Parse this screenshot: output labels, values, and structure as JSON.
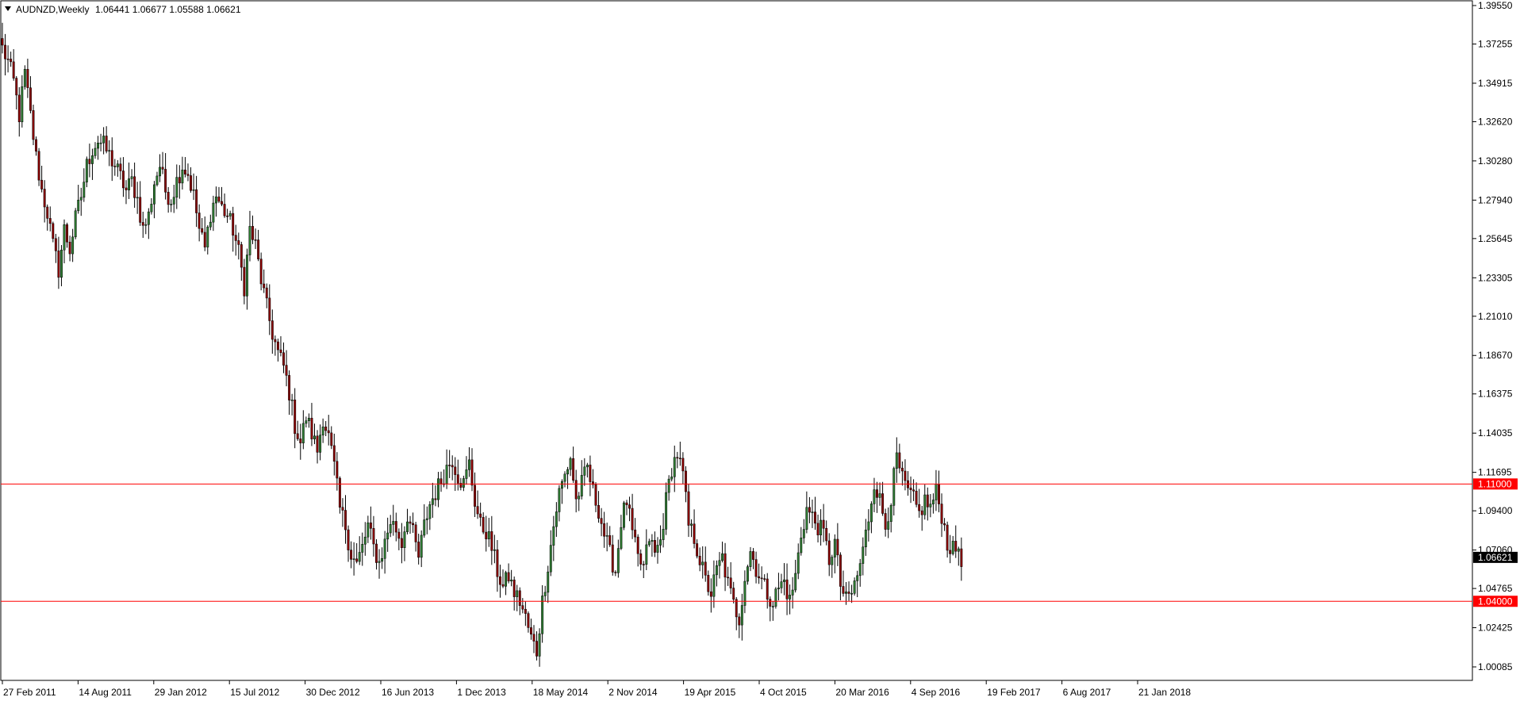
{
  "header": {
    "symbol_timeframe": "AUDNZD,Weekly",
    "ohlc": "1.06441 1.06677 1.05588 1.06621",
    "dropdown_icon": "triangle-down-icon"
  },
  "colors": {
    "bull_candle": "#2e7d32",
    "bear_candle": "#8b0000",
    "hline": "#ff0000",
    "axis": "#000000",
    "current_price_bg": "#000000",
    "level_badge_bg": "#ff0000"
  },
  "chart_data": {
    "type": "candlestick",
    "timeframe": "Weekly",
    "symbol": "AUDNZD",
    "y_axis": {
      "position": "right",
      "ylim": [
        0.99,
        1.4
      ],
      "ticks": [
        "1.39550",
        "1.37255",
        "1.34915",
        "1.32620",
        "1.30280",
        "1.27940",
        "1.25645",
        "1.23305",
        "1.21010",
        "1.18670",
        "1.16375",
        "1.14035",
        "1.11695",
        "1.09400",
        "1.07060",
        "1.04765",
        "1.02425",
        "1.00085"
      ]
    },
    "x_axis": {
      "ticks": [
        "27 Feb 2011",
        "14 Aug 2011",
        "29 Jan 2012",
        "15 Jul 2012",
        "30 Dec 2012",
        "16 Jun 2013",
        "1 Dec 2013",
        "18 May 2014",
        "2 Nov 2014",
        "19 Apr 2015",
        "4 Oct 2015",
        "20 Mar 2016",
        "4 Sep 2016",
        "19 Feb 2017",
        "6 Aug 2017",
        "21 Jan 2018"
      ]
    },
    "horizontal_levels": [
      {
        "value": 1.11,
        "label": "1.11000"
      },
      {
        "value": 1.04,
        "label": "1.04000"
      }
    ],
    "current_price": {
      "value": 1.06621,
      "label": "1.06621"
    },
    "price_path": [
      [
        0,
        1.37
      ],
      [
        2,
        1.362
      ],
      [
        4,
        1.35
      ],
      [
        6,
        1.33
      ],
      [
        8,
        1.355
      ],
      [
        10,
        1.33
      ],
      [
        12,
        1.305
      ],
      [
        14,
        1.285
      ],
      [
        16,
        1.272
      ],
      [
        18,
        1.252
      ],
      [
        20,
        1.238
      ],
      [
        22,
        1.262
      ],
      [
        24,
        1.25
      ],
      [
        26,
        1.268
      ],
      [
        28,
        1.282
      ],
      [
        30,
        1.3
      ],
      [
        32,
        1.31
      ],
      [
        34,
        1.315
      ],
      [
        36,
        1.312
      ],
      [
        38,
        1.306
      ],
      [
        40,
        1.3
      ],
      [
        42,
        1.293
      ],
      [
        44,
        1.285
      ],
      [
        46,
        1.291
      ],
      [
        48,
        1.28
      ],
      [
        50,
        1.262
      ],
      [
        52,
        1.27
      ],
      [
        54,
        1.29
      ],
      [
        56,
        1.3
      ],
      [
        58,
        1.285
      ],
      [
        60,
        1.28
      ],
      [
        62,
        1.291
      ],
      [
        64,
        1.3
      ],
      [
        66,
        1.295
      ],
      [
        68,
        1.282
      ],
      [
        70,
        1.262
      ],
      [
        72,
        1.25
      ],
      [
        74,
        1.272
      ],
      [
        76,
        1.282
      ],
      [
        78,
        1.275
      ],
      [
        80,
        1.27
      ],
      [
        82,
        1.262
      ],
      [
        84,
        1.248
      ],
      [
        86,
        1.228
      ],
      [
        88,
        1.262
      ],
      [
        90,
        1.252
      ],
      [
        92,
        1.232
      ],
      [
        94,
        1.215
      ],
      [
        96,
        1.2
      ],
      [
        98,
        1.188
      ],
      [
        100,
        1.18
      ],
      [
        102,
        1.165
      ],
      [
        104,
        1.145
      ],
      [
        106,
        1.135
      ],
      [
        108,
        1.15
      ],
      [
        110,
        1.14
      ],
      [
        112,
        1.13
      ],
      [
        114,
        1.15
      ],
      [
        116,
        1.138
      ],
      [
        118,
        1.12
      ],
      [
        120,
        1.095
      ],
      [
        122,
        1.085
      ],
      [
        124,
        1.068
      ],
      [
        126,
        1.062
      ],
      [
        128,
        1.072
      ],
      [
        130,
        1.085
      ],
      [
        132,
        1.072
      ],
      [
        134,
        1.063
      ],
      [
        136,
        1.075
      ],
      [
        138,
        1.088
      ],
      [
        140,
        1.083
      ],
      [
        142,
        1.075
      ],
      [
        144,
        1.092
      ],
      [
        146,
        1.08
      ],
      [
        148,
        1.066
      ],
      [
        150,
        1.085
      ],
      [
        152,
        1.098
      ],
      [
        154,
        1.105
      ],
      [
        156,
        1.112
      ],
      [
        158,
        1.12
      ],
      [
        160,
        1.125
      ],
      [
        162,
        1.115
      ],
      [
        164,
        1.11
      ],
      [
        166,
        1.122
      ],
      [
        168,
        1.1
      ],
      [
        170,
        1.085
      ],
      [
        172,
        1.082
      ],
      [
        174,
        1.072
      ],
      [
        176,
        1.058
      ],
      [
        178,
        1.048
      ],
      [
        180,
        1.055
      ],
      [
        182,
        1.045
      ],
      [
        184,
        1.04
      ],
      [
        186,
        1.03
      ],
      [
        188,
        1.018
      ],
      [
        190,
        1.01
      ],
      [
        192,
        1.04
      ],
      [
        194,
        1.062
      ],
      [
        196,
        1.085
      ],
      [
        198,
        1.105
      ],
      [
        200,
        1.115
      ],
      [
        202,
        1.126
      ],
      [
        204,
        1.1
      ],
      [
        206,
        1.11
      ],
      [
        208,
        1.12
      ],
      [
        210,
        1.105
      ],
      [
        212,
        1.095
      ],
      [
        214,
        1.08
      ],
      [
        216,
        1.068
      ],
      [
        218,
        1.058
      ],
      [
        220,
        1.088
      ],
      [
        222,
        1.1
      ],
      [
        224,
        1.08
      ],
      [
        226,
        1.065
      ],
      [
        228,
        1.06
      ],
      [
        230,
        1.078
      ],
      [
        232,
        1.068
      ],
      [
        234,
        1.076
      ],
      [
        236,
        1.1
      ],
      [
        238,
        1.12
      ],
      [
        240,
        1.128
      ],
      [
        242,
        1.115
      ],
      [
        244,
        1.085
      ],
      [
        246,
        1.078
      ],
      [
        248,
        1.065
      ],
      [
        250,
        1.052
      ],
      [
        252,
        1.045
      ],
      [
        254,
        1.058
      ],
      [
        256,
        1.066
      ],
      [
        258,
        1.05
      ],
      [
        260,
        1.038
      ],
      [
        262,
        1.03
      ],
      [
        264,
        1.055
      ],
      [
        266,
        1.07
      ],
      [
        268,
        1.06
      ],
      [
        270,
        1.052
      ],
      [
        272,
        1.045
      ],
      [
        274,
        1.04
      ],
      [
        276,
        1.048
      ],
      [
        278,
        1.052
      ],
      [
        280,
        1.04
      ],
      [
        282,
        1.055
      ],
      [
        284,
        1.08
      ],
      [
        286,
        1.095
      ],
      [
        288,
        1.09
      ],
      [
        290,
        1.085
      ],
      [
        292,
        1.08
      ],
      [
        294,
        1.065
      ],
      [
        296,
        1.075
      ],
      [
        298,
        1.05
      ],
      [
        300,
        1.04
      ],
      [
        302,
        1.045
      ],
      [
        304,
        1.055
      ],
      [
        306,
        1.07
      ],
      [
        308,
        1.09
      ],
      [
        310,
        1.112
      ],
      [
        312,
        1.1
      ],
      [
        314,
        1.085
      ],
      [
        316,
        1.102
      ],
      [
        318,
        1.125
      ],
      [
        320,
        1.112
      ],
      [
        322,
        1.105
      ],
      [
        324,
        1.1
      ],
      [
        326,
        1.092
      ],
      [
        328,
        1.1
      ],
      [
        330,
        1.096
      ],
      [
        332,
        1.105
      ],
      [
        334,
        1.092
      ],
      [
        336,
        1.075
      ],
      [
        338,
        1.07
      ],
      [
        340,
        1.072
      ],
      [
        341,
        1.066
      ]
    ]
  }
}
